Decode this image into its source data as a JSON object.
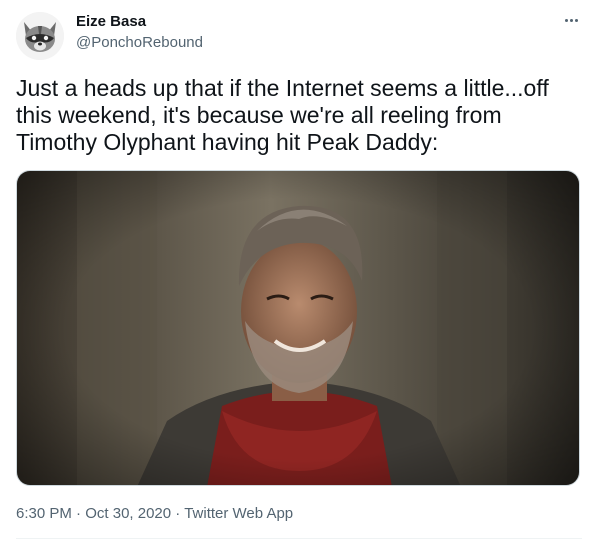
{
  "tweet": {
    "author": {
      "name": "Eize Basa",
      "handle": "@PonchoRebound"
    },
    "text": "Just a heads up that if the Internet seems a little...off this weekend, it's because we're all reeling from Timothy Olyphant having hit Peak Daddy:",
    "time": "6:30 PM",
    "date": "Oct 30, 2020",
    "source": "Twitter Web App",
    "separator": "·",
    "more_icon": "more-dots-icon"
  },
  "colors": {
    "text_primary": "#0f1419",
    "text_secondary": "#536471",
    "border": "#cfd9de"
  }
}
